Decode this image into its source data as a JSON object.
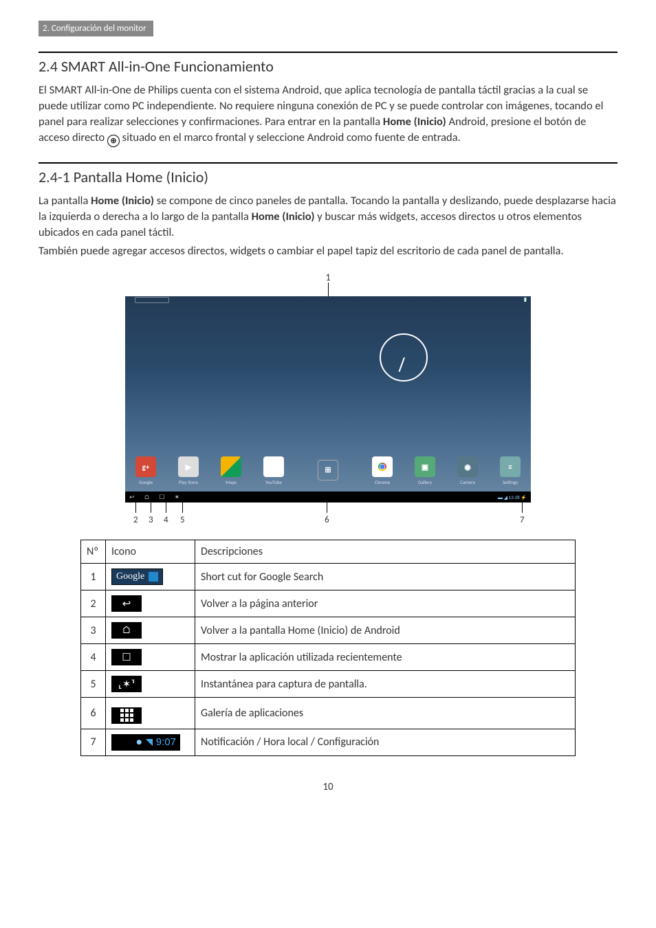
{
  "header_tab": "2. Configuración del monitor",
  "s24": {
    "title": "2.4  SMART All-in-One Funcionamiento",
    "p1a": "El SMART All-in-One de Philips cuenta con el sistema Android, que aplica tecnología de pantalla táctil gracias a la cual se puede utilizar como PC independiente. No requiere ninguna conexión de PC y se puede controlar con imágenes, tocando el panel para realizar selecciones y confirmaciones. Para entrar en la pantalla ",
    "p1b_bold": "Home (Inicio)",
    "p1c": " Android, presione el botón de acceso directo ",
    "p1d": " situado en el marco frontal y seleccione Android como fuente de entrada."
  },
  "s241": {
    "title": "2.4-1  Pantalla Home (Inicio)",
    "p1a": "La pantalla ",
    "p1b_bold": "Home (Inicio)",
    "p1c": " se compone de cinco paneles de pantalla. Tocando la pantalla y deslizando, puede desplazarse hacia la izquierda o derecha a lo largo de la pantalla ",
    "p1d_bold": "Home (Inicio)",
    "p1e": " y buscar más widgets, accesos directos u otros elementos ubicados en cada panel táctil.",
    "p2": "También puede agregar accesos directos, widgets o cambiar el papel tapiz del escritorio de cada panel de pantalla."
  },
  "callouts": {
    "c1": "1",
    "c2": "2",
    "c3": "3",
    "c4": "4",
    "c5": "5",
    "c6": "6",
    "c7": "7"
  },
  "dock": {
    "google": "Google",
    "play": "Play Store",
    "maps": "Maps",
    "youtube": "YouTube",
    "chrome": "Chrome",
    "gallery": "Gallery",
    "camera": "Camera",
    "settings": "Settings"
  },
  "nav_time": "12:28",
  "table": {
    "h1": "Nº",
    "h2": "Icono",
    "h3": "Descripciones",
    "rows": [
      {
        "n": "1",
        "icon": "google",
        "desc": "Short cut for Google Search"
      },
      {
        "n": "2",
        "icon": "back",
        "desc": "Volver a la página anterior"
      },
      {
        "n": "3",
        "icon": "home",
        "desc": "Volver a la pantalla Home (Inicio) de Android"
      },
      {
        "n": "4",
        "icon": "recent",
        "desc": "Mostrar la aplicación utilizada recientemente"
      },
      {
        "n": "5",
        "icon": "snap",
        "desc": "Instantánea para captura de pantalla."
      },
      {
        "n": "6",
        "icon": "apps",
        "desc": "Galería de aplicaciones"
      },
      {
        "n": "7",
        "icon": "status",
        "desc": "Notificación / Hora local / Configuración"
      }
    ],
    "status_time": "9:07",
    "google_label": "Google"
  },
  "page_number": "10"
}
